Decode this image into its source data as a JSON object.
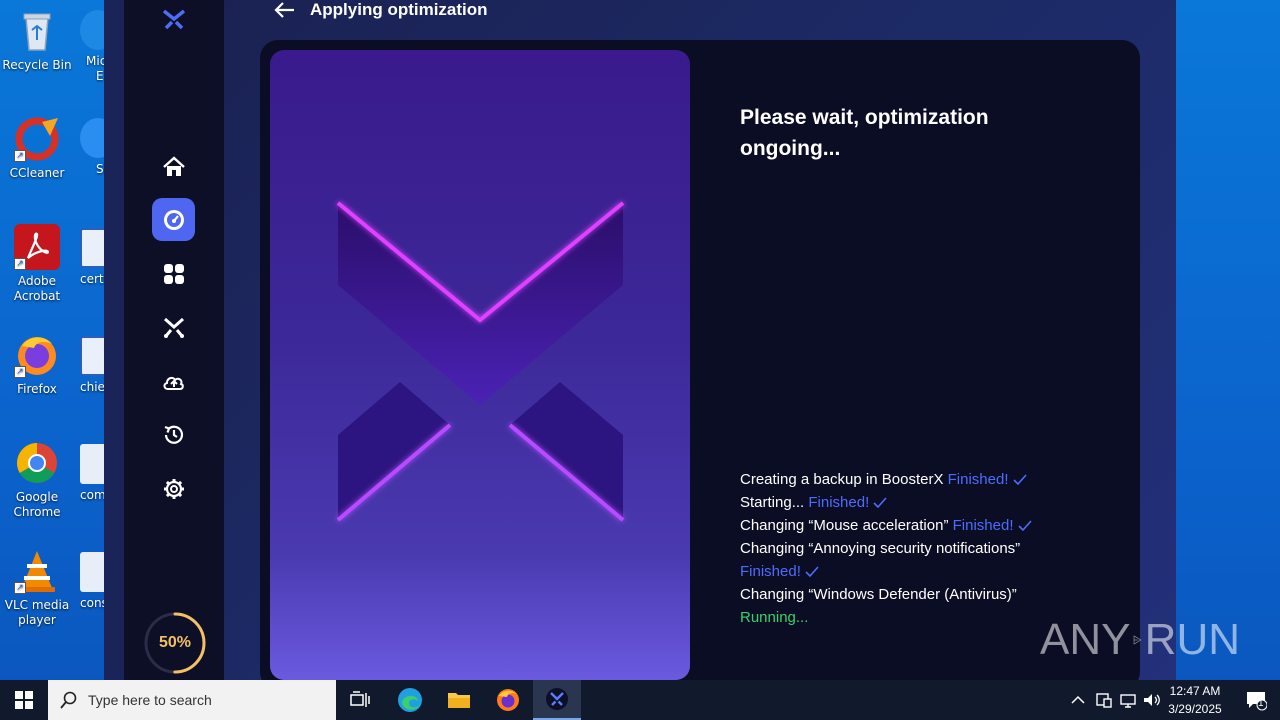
{
  "desktop": {
    "icons": [
      {
        "label_line1": "Recycle Bin",
        "label_line2": ""
      },
      {
        "label_line1": "CCleaner",
        "label_line2": ""
      },
      {
        "label_line1": "Adobe",
        "label_line2": "Acrobat"
      },
      {
        "label_line1": "Firefox",
        "label_line2": ""
      },
      {
        "label_line1": "Google",
        "label_line2": "Chrome"
      },
      {
        "label_line1": "VLC media",
        "label_line2": "player"
      }
    ],
    "partial_icons": [
      "Mic",
      "E",
      "Sl",
      "certi",
      "chief",
      "com",
      "cons"
    ]
  },
  "app": {
    "header_title": "Applying optimization",
    "status_title": "Please wait, optimization ongoing...",
    "progress_label": "50%",
    "progress_value": 0.5,
    "accent_color": "#4e66f0",
    "finished_color": "#4d6cff",
    "running_color": "#37d36a",
    "progress_color": "#f4c064",
    "nav_icons": [
      "home-icon",
      "speedometer-icon",
      "apps-grid-icon",
      "boosterx-icon",
      "cloud-upload-icon",
      "history-icon",
      "gear-icon"
    ],
    "log": [
      {
        "text": "Creating a backup in BoosterX",
        "status": "Finished!"
      },
      {
        "text": "Starting...",
        "status": "Finished!"
      },
      {
        "text": "Changing “Mouse acceleration”",
        "status": "Finished!"
      },
      {
        "text": "Changing “Annoying security notifications”",
        "status": "Finished!"
      },
      {
        "text": "Changing “Windows Defender (Antivirus)”",
        "status": "Running..."
      }
    ]
  },
  "watermark": {
    "left": "ANY",
    "right": "RUN"
  },
  "taskbar": {
    "search_placeholder": "Type here to search",
    "time": "12:47 AM",
    "date": "3/29/2025",
    "notification_count": "1"
  }
}
